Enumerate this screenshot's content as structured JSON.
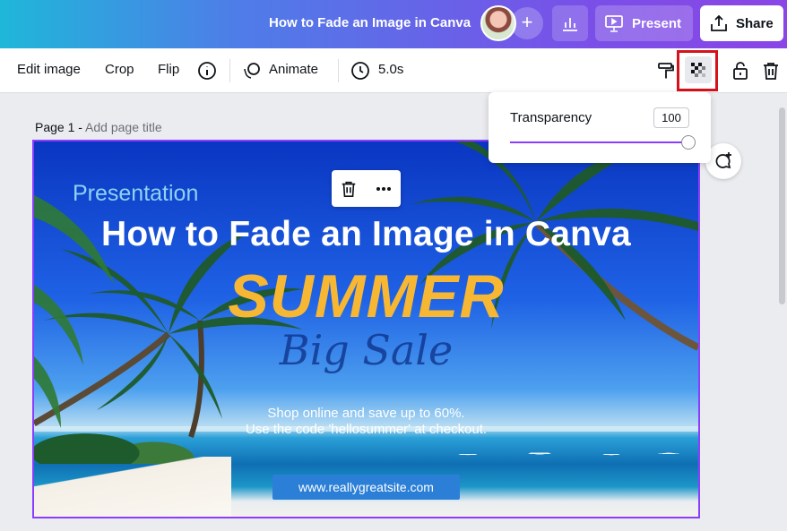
{
  "header": {
    "doc_title": "How to Fade an Image in Canva",
    "add_collaborator": "+",
    "present_label": "Present",
    "share_label": "Share"
  },
  "toolbar": {
    "edit_image": "Edit image",
    "crop": "Crop",
    "flip": "Flip",
    "animate": "Animate",
    "duration": "5.0s"
  },
  "page": {
    "label": "Page 1 - ",
    "title_placeholder": "Add page title"
  },
  "design": {
    "presentation": "Presentation",
    "title": "How to Fade an Image in Canva",
    "summer": "SUMMER",
    "big_sale": "Big Sale",
    "shop_line1": "Shop online and save up to 60%.",
    "shop_line2": "Use the code 'hellosummer' at checkout.",
    "url": "www.reallygreatsite.com"
  },
  "transparency": {
    "label": "Transparency",
    "value": "100",
    "slider_fraction": 1.0
  },
  "colors": {
    "accent": "#8b3dff",
    "highlight": "#d5121b"
  }
}
